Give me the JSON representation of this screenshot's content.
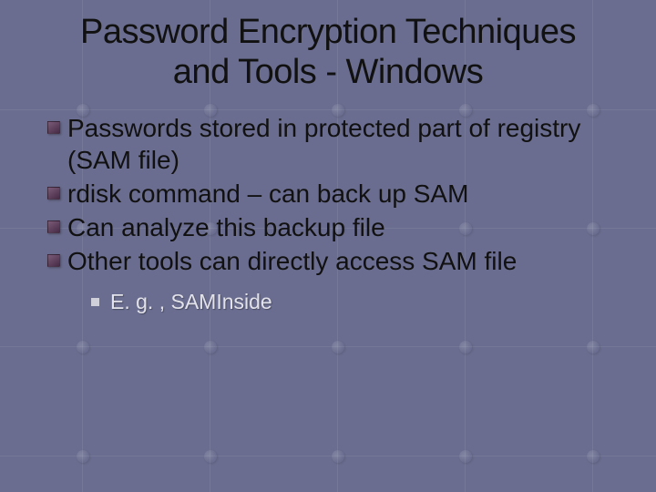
{
  "title_line1": "Password Encryption Techniques",
  "title_line2": "and Tools - Windows",
  "bullets": {
    "b0": "Passwords stored in protected part of registry (SAM file)",
    "b1": "rdisk command – can back up SAM",
    "b2": "Can analyze this backup file",
    "b3": "Other tools can directly access SAM file"
  },
  "sub": {
    "s0": "E. g. , SAMInside"
  }
}
